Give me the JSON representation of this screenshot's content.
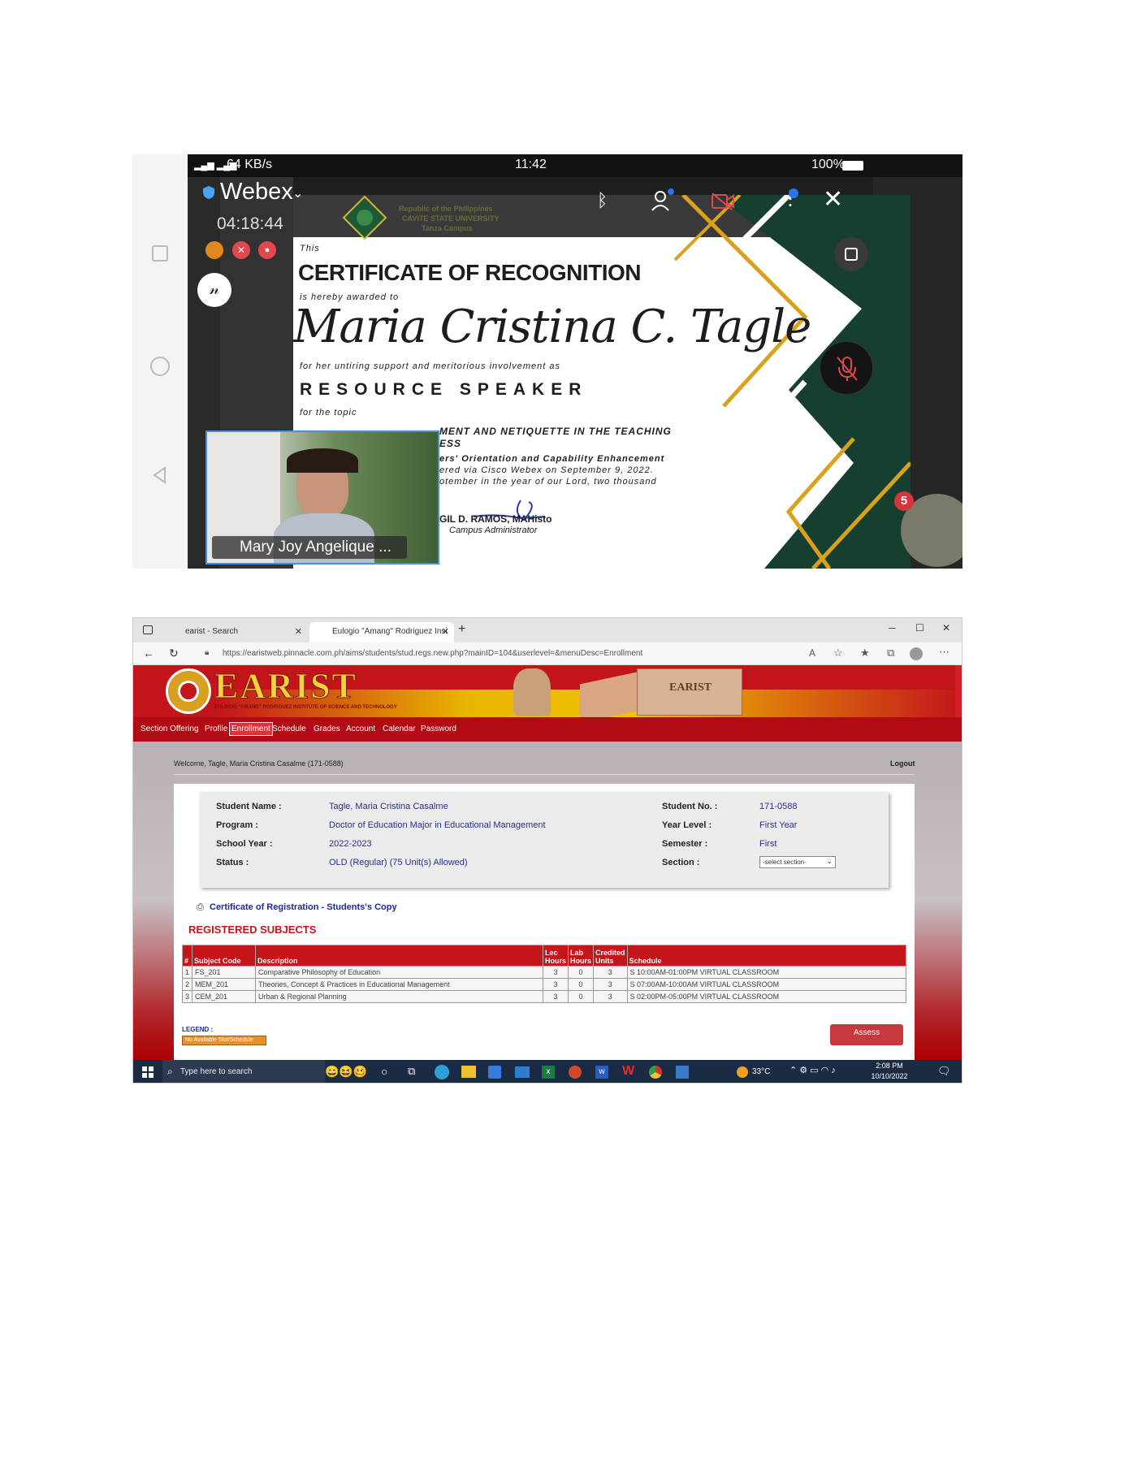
{
  "mobile": {
    "status": {
      "signal": "64 KB/s",
      "time": "11:42",
      "battery": "100%"
    },
    "app": {
      "name": "Webex",
      "timer": "04:18:44"
    },
    "certificate": {
      "header_line1": "Republic of the Philippines",
      "header_line2": "CAVITE STATE UNIVERSITY",
      "header_line3": "Tanza Campus",
      "this": "This",
      "title": "CERTIFICATE OF RECOGNITION",
      "awarded": "is hereby awarded to",
      "recipient": "Maria Cristina C. Tagle",
      "for_her": "for her untiring support and meritorious involvement as",
      "role": "RESOURCE SPEAKER",
      "for_topic": "for the topic",
      "topic_l1": "MENT AND NETIQUETTE IN THE TEACHING",
      "topic_l2": "ESS",
      "event_l1": "ers' Orientation and Capability Enhancement",
      "event_l2": "ered via Cisco Webex on September 9, 2022.",
      "event_l3": "otember in the year of our Lord, two thousand",
      "signer": "GIL D. RAMOS, MAHisto",
      "signer_title": "Campus Administrator"
    },
    "participant": {
      "name": "Mary Joy Angelique ...",
      "count": "5"
    }
  },
  "browser": {
    "tab1": "earist - Search",
    "tab2": "Eulogio \"Amang\" Rodriguez Insi",
    "url": "https://earistweb.pinnacle.com.ph/aims/students/stud.regs.new.php?mainID=104&userlevel=&menuDesc=Enrollment"
  },
  "site": {
    "logo_text": "EARIST",
    "logo_sub": "EULOGIO \"AMANG\" RODRIGUEZ INSTITUTE OF SCIENCE AND TECHNOLOGY",
    "sign_text": "EARIST",
    "menu": [
      "Section Offering",
      "Profile",
      "Enrollment",
      "Schedule",
      "Grades",
      "Account",
      "Calendar",
      "Password"
    ],
    "welcome": "Welcome, Tagle, Maria Cristina Casalme (171-0588)",
    "logout": "Logout",
    "student": {
      "name_label": "Student Name  :",
      "name": "Tagle, Maria Cristina Casalme",
      "program_label": "Program  :",
      "program": "Doctor of Education Major in Educational Management",
      "year_label": "School Year  :",
      "year": "2022-2023",
      "status_label": "Status  :",
      "status": "OLD (Regular) (75 Unit(s) Allowed)",
      "no_label": "Student No.  :",
      "no": "171-0588",
      "level_label": "Year Level  :",
      "level": "First Year",
      "sem_label": "Semester  :",
      "sem": "First",
      "section_label": "Section  :",
      "section": "-select section-"
    },
    "cor_link": "Certificate of Registration - Students's Copy",
    "registered_title": "REGISTERED SUBJECTS",
    "table_headers": [
      "#",
      "Subject Code",
      "Description",
      "Lec Hours",
      "Lab Hours",
      "Credited Units",
      "Schedule"
    ],
    "subjects": [
      [
        "1",
        "FS_201",
        "Comparative Philosophy of Education",
        "3",
        "0",
        "3",
        "S 10:00AM-01:00PM VIRTUAL CLASSROOM"
      ],
      [
        "2",
        "MEM_201",
        "Theories, Concept & Practices in Educational Management",
        "3",
        "0",
        "3",
        "S 07:00AM-10:00AM VIRTUAL CLASSROOM"
      ],
      [
        "3",
        "CEM_201",
        "Urban & Regional Planning",
        "3",
        "0",
        "3",
        "S 02:00PM-05:00PM VIRTUAL CLASSROOM"
      ]
    ],
    "legend": "LEGEND :",
    "legend_item": "No Available Slot/Schedule",
    "assess": "Assess"
  },
  "taskbar": {
    "search": "Type here to search",
    "temp": "33°C",
    "time": "2:08 PM",
    "date": "10/10/2022"
  }
}
